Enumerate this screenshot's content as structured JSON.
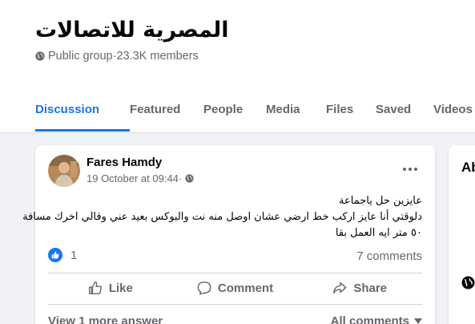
{
  "group": {
    "name": "المصرية للاتصالات",
    "privacy": "Public group",
    "separator": " · ",
    "members": "23.3K members"
  },
  "tabs": [
    {
      "label": "Discussion",
      "active": true
    },
    {
      "label": "Featured",
      "active": false
    },
    {
      "label": "People",
      "active": false
    },
    {
      "label": "Media",
      "active": false
    },
    {
      "label": "Files",
      "active": false
    },
    {
      "label": "Saved",
      "active": false
    },
    {
      "label": "Videos",
      "active": false
    }
  ],
  "post": {
    "author": "Fares Hamdy",
    "timestamp": "19 October at 09:44",
    "meta_separator": " · ",
    "text_lines": [
      "عايزين حل ياجماعة",
      "دلوقتي أنا عايز اركب خط ارضي عشان اوصل منه نت والبوكس بعيد عني وقالي اخرك مسافة",
      "٥٠ متر ايه العمل بقا"
    ],
    "reaction_count": "1",
    "comments_count": "7 comments",
    "actions": {
      "like": "Like",
      "comment": "Comment",
      "share": "Share"
    },
    "view_more": "View 1 more answer",
    "all_comments": "All comments"
  },
  "right_panel": {
    "heading": "Ab"
  },
  "colors": {
    "accent": "#1b74e4",
    "text_secondary": "#65676b",
    "background": "#f0f2f5",
    "like_blue": "#1877f2"
  },
  "icons": [
    "globe-icon",
    "more-options-icon",
    "like-reaction-icon",
    "like-icon",
    "comment-icon",
    "share-icon",
    "chevron-down-icon"
  ]
}
